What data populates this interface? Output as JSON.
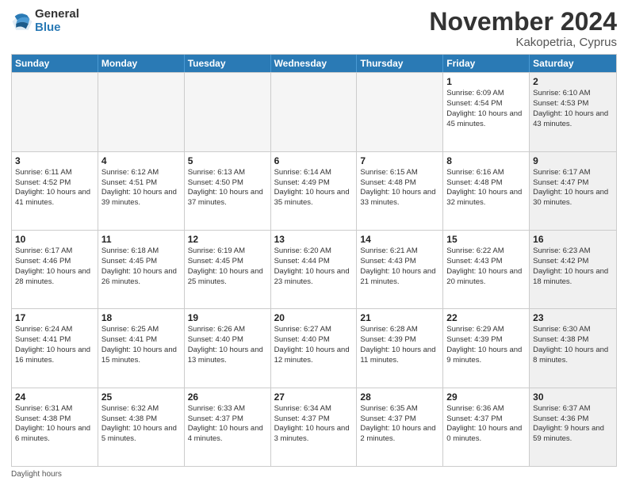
{
  "logo": {
    "general": "General",
    "blue": "Blue"
  },
  "title": "November 2024",
  "subtitle": "Kakopetria, Cyprus",
  "header_days": [
    "Sunday",
    "Monday",
    "Tuesday",
    "Wednesday",
    "Thursday",
    "Friday",
    "Saturday"
  ],
  "footer": "Daylight hours",
  "weeks": [
    [
      {
        "day": "",
        "sunrise": "",
        "sunset": "",
        "daylight": "",
        "shaded": false,
        "empty": true
      },
      {
        "day": "",
        "sunrise": "",
        "sunset": "",
        "daylight": "",
        "shaded": false,
        "empty": true
      },
      {
        "day": "",
        "sunrise": "",
        "sunset": "",
        "daylight": "",
        "shaded": false,
        "empty": true
      },
      {
        "day": "",
        "sunrise": "",
        "sunset": "",
        "daylight": "",
        "shaded": false,
        "empty": true
      },
      {
        "day": "",
        "sunrise": "",
        "sunset": "",
        "daylight": "",
        "shaded": false,
        "empty": true
      },
      {
        "day": "1",
        "sunrise": "Sunrise: 6:09 AM",
        "sunset": "Sunset: 4:54 PM",
        "daylight": "Daylight: 10 hours and 45 minutes.",
        "shaded": false,
        "empty": false
      },
      {
        "day": "2",
        "sunrise": "Sunrise: 6:10 AM",
        "sunset": "Sunset: 4:53 PM",
        "daylight": "Daylight: 10 hours and 43 minutes.",
        "shaded": true,
        "empty": false
      }
    ],
    [
      {
        "day": "3",
        "sunrise": "Sunrise: 6:11 AM",
        "sunset": "Sunset: 4:52 PM",
        "daylight": "Daylight: 10 hours and 41 minutes.",
        "shaded": false,
        "empty": false
      },
      {
        "day": "4",
        "sunrise": "Sunrise: 6:12 AM",
        "sunset": "Sunset: 4:51 PM",
        "daylight": "Daylight: 10 hours and 39 minutes.",
        "shaded": false,
        "empty": false
      },
      {
        "day": "5",
        "sunrise": "Sunrise: 6:13 AM",
        "sunset": "Sunset: 4:50 PM",
        "daylight": "Daylight: 10 hours and 37 minutes.",
        "shaded": false,
        "empty": false
      },
      {
        "day": "6",
        "sunrise": "Sunrise: 6:14 AM",
        "sunset": "Sunset: 4:49 PM",
        "daylight": "Daylight: 10 hours and 35 minutes.",
        "shaded": false,
        "empty": false
      },
      {
        "day": "7",
        "sunrise": "Sunrise: 6:15 AM",
        "sunset": "Sunset: 4:48 PM",
        "daylight": "Daylight: 10 hours and 33 minutes.",
        "shaded": false,
        "empty": false
      },
      {
        "day": "8",
        "sunrise": "Sunrise: 6:16 AM",
        "sunset": "Sunset: 4:48 PM",
        "daylight": "Daylight: 10 hours and 32 minutes.",
        "shaded": false,
        "empty": false
      },
      {
        "day": "9",
        "sunrise": "Sunrise: 6:17 AM",
        "sunset": "Sunset: 4:47 PM",
        "daylight": "Daylight: 10 hours and 30 minutes.",
        "shaded": true,
        "empty": false
      }
    ],
    [
      {
        "day": "10",
        "sunrise": "Sunrise: 6:17 AM",
        "sunset": "Sunset: 4:46 PM",
        "daylight": "Daylight: 10 hours and 28 minutes.",
        "shaded": false,
        "empty": false
      },
      {
        "day": "11",
        "sunrise": "Sunrise: 6:18 AM",
        "sunset": "Sunset: 4:45 PM",
        "daylight": "Daylight: 10 hours and 26 minutes.",
        "shaded": false,
        "empty": false
      },
      {
        "day": "12",
        "sunrise": "Sunrise: 6:19 AM",
        "sunset": "Sunset: 4:45 PM",
        "daylight": "Daylight: 10 hours and 25 minutes.",
        "shaded": false,
        "empty": false
      },
      {
        "day": "13",
        "sunrise": "Sunrise: 6:20 AM",
        "sunset": "Sunset: 4:44 PM",
        "daylight": "Daylight: 10 hours and 23 minutes.",
        "shaded": false,
        "empty": false
      },
      {
        "day": "14",
        "sunrise": "Sunrise: 6:21 AM",
        "sunset": "Sunset: 4:43 PM",
        "daylight": "Daylight: 10 hours and 21 minutes.",
        "shaded": false,
        "empty": false
      },
      {
        "day": "15",
        "sunrise": "Sunrise: 6:22 AM",
        "sunset": "Sunset: 4:43 PM",
        "daylight": "Daylight: 10 hours and 20 minutes.",
        "shaded": false,
        "empty": false
      },
      {
        "day": "16",
        "sunrise": "Sunrise: 6:23 AM",
        "sunset": "Sunset: 4:42 PM",
        "daylight": "Daylight: 10 hours and 18 minutes.",
        "shaded": true,
        "empty": false
      }
    ],
    [
      {
        "day": "17",
        "sunrise": "Sunrise: 6:24 AM",
        "sunset": "Sunset: 4:41 PM",
        "daylight": "Daylight: 10 hours and 16 minutes.",
        "shaded": false,
        "empty": false
      },
      {
        "day": "18",
        "sunrise": "Sunrise: 6:25 AM",
        "sunset": "Sunset: 4:41 PM",
        "daylight": "Daylight: 10 hours and 15 minutes.",
        "shaded": false,
        "empty": false
      },
      {
        "day": "19",
        "sunrise": "Sunrise: 6:26 AM",
        "sunset": "Sunset: 4:40 PM",
        "daylight": "Daylight: 10 hours and 13 minutes.",
        "shaded": false,
        "empty": false
      },
      {
        "day": "20",
        "sunrise": "Sunrise: 6:27 AM",
        "sunset": "Sunset: 4:40 PM",
        "daylight": "Daylight: 10 hours and 12 minutes.",
        "shaded": false,
        "empty": false
      },
      {
        "day": "21",
        "sunrise": "Sunrise: 6:28 AM",
        "sunset": "Sunset: 4:39 PM",
        "daylight": "Daylight: 10 hours and 11 minutes.",
        "shaded": false,
        "empty": false
      },
      {
        "day": "22",
        "sunrise": "Sunrise: 6:29 AM",
        "sunset": "Sunset: 4:39 PM",
        "daylight": "Daylight: 10 hours and 9 minutes.",
        "shaded": false,
        "empty": false
      },
      {
        "day": "23",
        "sunrise": "Sunrise: 6:30 AM",
        "sunset": "Sunset: 4:38 PM",
        "daylight": "Daylight: 10 hours and 8 minutes.",
        "shaded": true,
        "empty": false
      }
    ],
    [
      {
        "day": "24",
        "sunrise": "Sunrise: 6:31 AM",
        "sunset": "Sunset: 4:38 PM",
        "daylight": "Daylight: 10 hours and 6 minutes.",
        "shaded": false,
        "empty": false
      },
      {
        "day": "25",
        "sunrise": "Sunrise: 6:32 AM",
        "sunset": "Sunset: 4:38 PM",
        "daylight": "Daylight: 10 hours and 5 minutes.",
        "shaded": false,
        "empty": false
      },
      {
        "day": "26",
        "sunrise": "Sunrise: 6:33 AM",
        "sunset": "Sunset: 4:37 PM",
        "daylight": "Daylight: 10 hours and 4 minutes.",
        "shaded": false,
        "empty": false
      },
      {
        "day": "27",
        "sunrise": "Sunrise: 6:34 AM",
        "sunset": "Sunset: 4:37 PM",
        "daylight": "Daylight: 10 hours and 3 minutes.",
        "shaded": false,
        "empty": false
      },
      {
        "day": "28",
        "sunrise": "Sunrise: 6:35 AM",
        "sunset": "Sunset: 4:37 PM",
        "daylight": "Daylight: 10 hours and 2 minutes.",
        "shaded": false,
        "empty": false
      },
      {
        "day": "29",
        "sunrise": "Sunrise: 6:36 AM",
        "sunset": "Sunset: 4:37 PM",
        "daylight": "Daylight: 10 hours and 0 minutes.",
        "shaded": false,
        "empty": false
      },
      {
        "day": "30",
        "sunrise": "Sunrise: 6:37 AM",
        "sunset": "Sunset: 4:36 PM",
        "daylight": "Daylight: 9 hours and 59 minutes.",
        "shaded": true,
        "empty": false
      }
    ]
  ]
}
